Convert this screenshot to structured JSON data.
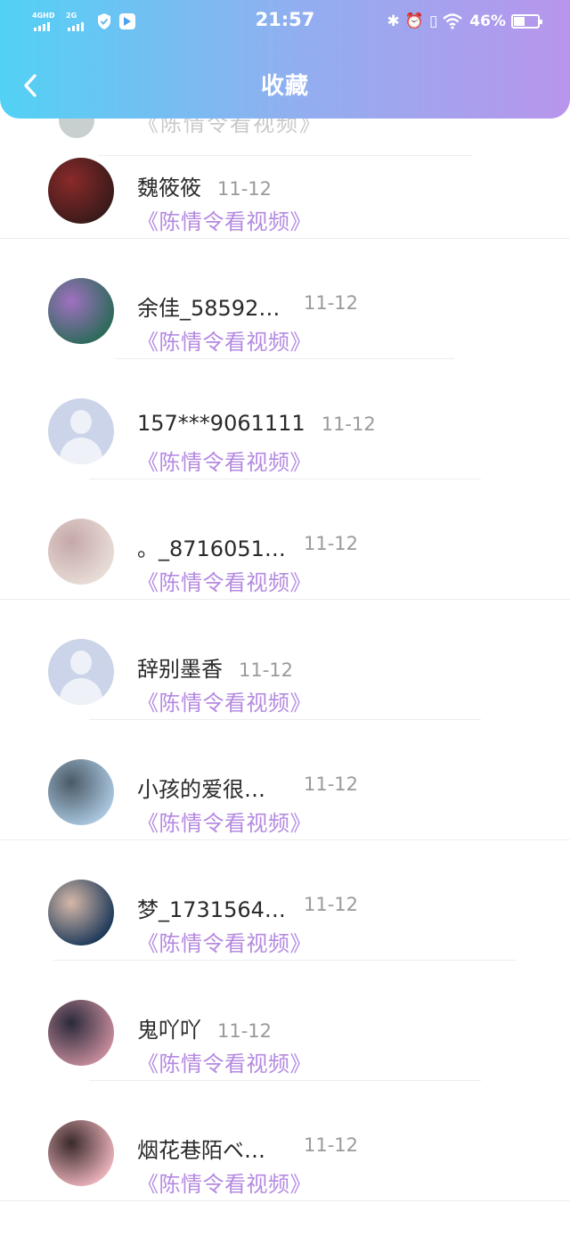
{
  "status_bar": {
    "network_1": "4GHD",
    "network_2": "2G",
    "time": "21:57",
    "battery_percent": "46%",
    "battery_level": 0.46
  },
  "header": {
    "title": "收藏",
    "back_icon": "chevron-left-icon"
  },
  "colors": {
    "header_gradient": [
      "#52d1f5",
      "#8fb0f0",
      "#b895ec"
    ],
    "video_title": "#b58ae0",
    "date": "#9a9a9a"
  },
  "items": [
    {
      "username": "魏筱筱",
      "date": "11-12",
      "video": "《陈情令看视频》",
      "avatar": "photo-avatar",
      "avatar_colors": [
        "#3a1a1a",
        "#8a2a2a"
      ]
    },
    {
      "username": "余佳_58592…",
      "date": "11-12",
      "video": "《陈情令看视频》",
      "avatar": "photo-avatar",
      "avatar_colors": [
        "#2d6a5a",
        "#a070c0"
      ]
    },
    {
      "username": "157***9061111",
      "date": "11-12",
      "video": "《陈情令看视频》",
      "avatar": "default-avatar"
    },
    {
      "username": "。_8716051…",
      "date": "11-12",
      "video": "《陈情令看视频》",
      "avatar": "photo-avatar",
      "avatar_colors": [
        "#e8dcd6",
        "#c4a8a8"
      ]
    },
    {
      "username": "辞别墨香",
      "date": "11-12",
      "video": "《陈情令看视频》",
      "avatar": "default-avatar"
    },
    {
      "username": "小孩的爱很…",
      "date": "11-12",
      "video": "《陈情令看视频》",
      "avatar": "photo-avatar",
      "avatar_colors": [
        "#a9c6de",
        "#4a5a66"
      ]
    },
    {
      "username": "梦_1731564…",
      "date": "11-12",
      "video": "《陈情令看视频》",
      "avatar": "photo-avatar",
      "avatar_colors": [
        "#1e3a5a",
        "#d6b8a8"
      ]
    },
    {
      "username": "鬼吖吖",
      "date": "11-12",
      "video": "《陈情令看视频》",
      "avatar": "photo-avatar",
      "avatar_colors": [
        "#c48a9a",
        "#2a2a3a"
      ]
    },
    {
      "username": "烟花巷陌ベ…",
      "date": "11-12",
      "video": "《陈情令看视频》",
      "avatar": "photo-avatar",
      "avatar_colors": [
        "#e8b0b8",
        "#3a2a2a"
      ]
    }
  ]
}
